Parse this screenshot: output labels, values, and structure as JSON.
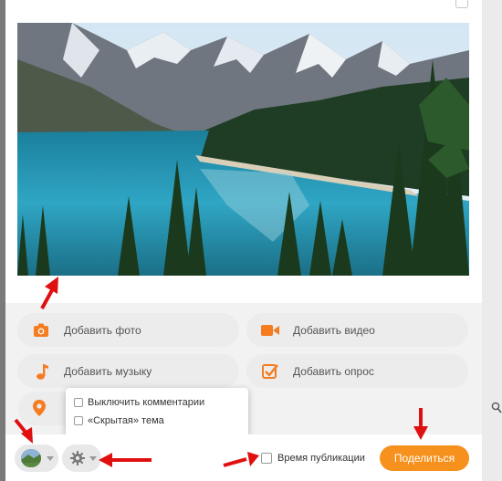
{
  "actions": {
    "add_photo": "Добавить фото",
    "add_video": "Добавить видео",
    "add_music": "Добавить музыку",
    "add_poll": "Добавить опрос"
  },
  "settings_menu": {
    "disable_comments": "Выключить комментарии",
    "hidden_topic": "«Скрытая» тема"
  },
  "bottom_bar": {
    "publication_time_label": "Время публикации",
    "share_label": "Поделиться"
  },
  "colors": {
    "accent": "#f7911e",
    "annotation_arrow": "#e01010"
  },
  "icons": [
    "camera-icon",
    "video-camera-icon",
    "music-note-icon",
    "poll-checkbox-icon",
    "location-pin-icon",
    "gear-icon",
    "search-icon"
  ]
}
